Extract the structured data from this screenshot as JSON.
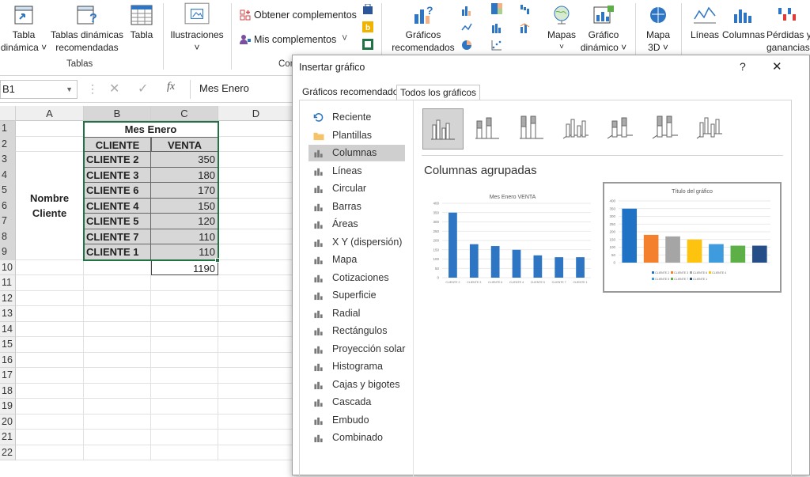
{
  "ribbon": {
    "tabla_dinamica": [
      "Tabla",
      "dinámica ˅"
    ],
    "tablas_din_rec": [
      "Tablas dinámicas",
      "recomendadas"
    ],
    "tabla": "Tabla",
    "group_tablas": "Tablas",
    "ilustraciones": "Ilustraciones",
    "ilustraciones_caret": "˅",
    "obtener": "Obtener complementos",
    "mis": "Mis complementos",
    "mis_caret": "˅",
    "group_complementos_partial": "Com",
    "graficos_rec": [
      "Gráficos",
      "recomendados"
    ],
    "mapas": "Mapas",
    "mapas_caret": "˅",
    "grafico_din": [
      "Gráfico",
      "dinámico ˅"
    ],
    "mapa3d": [
      "Mapa",
      "3D ˅"
    ],
    "lineas": "Líneas",
    "columnas": "Columnas",
    "perdidas": [
      "Pérdidas y",
      "ganancias"
    ]
  },
  "formula_bar": {
    "name_box": "B1",
    "content": "Mes Enero",
    "fx": "fx"
  },
  "columns": [
    "A",
    "B",
    "C",
    "D"
  ],
  "rows": [
    "1",
    "2",
    "3",
    "4",
    "5",
    "6",
    "7",
    "8",
    "9",
    "10",
    "11",
    "12",
    "13",
    "14",
    "15",
    "16",
    "17",
    "18",
    "19",
    "20",
    "21",
    "22"
  ],
  "sheet": {
    "title": "Mes Enero",
    "label_a": [
      "Nombre",
      "Cliente"
    ],
    "headers": [
      "CLIENTE",
      "VENTA"
    ],
    "data": [
      [
        "CLIENTE 2",
        "350"
      ],
      [
        "CLIENTE 3",
        "180"
      ],
      [
        "CLIENTE 6",
        "170"
      ],
      [
        "CLIENTE 4",
        "150"
      ],
      [
        "CLIENTE 5",
        "120"
      ],
      [
        "CLIENTE 7",
        "110"
      ],
      [
        "CLIENTE 1",
        "110"
      ]
    ],
    "total": "1190"
  },
  "dialog": {
    "title": "Insertar gráfico",
    "help": "?",
    "close": "✕",
    "tabs": [
      "Gráficos recomendados",
      "Todos los gráficos"
    ],
    "categories": [
      "Reciente",
      "Plantillas",
      "Columnas",
      "Líneas",
      "Circular",
      "Barras",
      "Áreas",
      "X Y (dispersión)",
      "Mapa",
      "Cotizaciones",
      "Superficie",
      "Radial",
      "Rectángulos",
      "Proyección solar",
      "Histograma",
      "Cajas y bigotes",
      "Cascada",
      "Embudo",
      "Combinado"
    ],
    "selected_category": "Columnas",
    "subtype_title": "Columnas agrupadas",
    "preview1_title": "Mes Enero VENTA",
    "preview2_title": "Título del gráfico",
    "legend": [
      "CLIENTE 2",
      "CLIENTE 3",
      "CLIENTE 6",
      "CLIENTE 4",
      "CLIENTE 5",
      "CLIENTE 7",
      "CLIENTE 1"
    ]
  },
  "chart_data": [
    {
      "type": "bar",
      "title": "Mes Enero VENTA",
      "categories": [
        "CLIENTE 2",
        "CLIENTE 3",
        "CLIENTE 6",
        "CLIENTE 4",
        "CLIENTE 5",
        "CLIENTE 7",
        "CLIENTE 1"
      ],
      "values": [
        350,
        180,
        170,
        150,
        120,
        110,
        110
      ],
      "ylim": [
        0,
        400
      ],
      "yticks": [
        "0",
        "50",
        "100",
        "150",
        "200",
        "250",
        "300",
        "350",
        "400"
      ],
      "color": "#2e75c4"
    },
    {
      "type": "bar",
      "title": "Título del gráfico",
      "series": [
        {
          "name": "CLIENTE 2",
          "values": [
            350
          ]
        },
        {
          "name": "CLIENTE 3",
          "values": [
            180
          ]
        },
        {
          "name": "CLIENTE 6",
          "values": [
            170
          ]
        },
        {
          "name": "CLIENTE 4",
          "values": [
            150
          ]
        },
        {
          "name": "CLIENTE 5",
          "values": [
            120
          ]
        },
        {
          "name": "CLIENTE 7",
          "values": [
            110
          ]
        },
        {
          "name": "CLIENTE 1",
          "values": [
            110
          ]
        }
      ],
      "ylim": [
        0,
        400
      ],
      "yticks": [
        "0",
        "50",
        "100",
        "150",
        "200",
        "250",
        "300",
        "350",
        "400"
      ],
      "colors": [
        "#1f72c4",
        "#f4802e",
        "#a5a5a5",
        "#fdc30f",
        "#3d9bde",
        "#5db046",
        "#254d87"
      ],
      "legend_position": "bottom"
    }
  ]
}
